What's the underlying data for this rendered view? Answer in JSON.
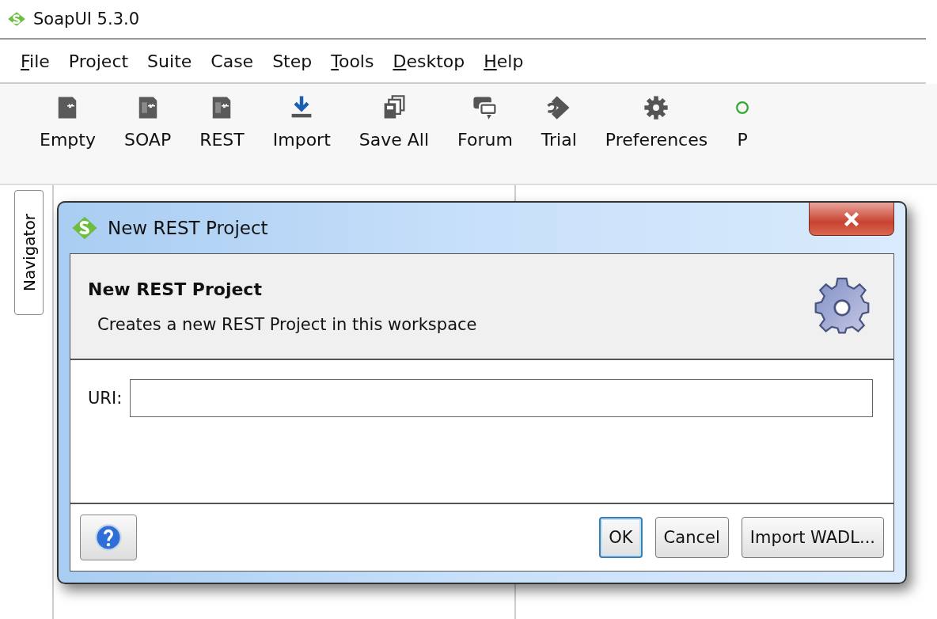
{
  "window": {
    "title": "SoapUI 5.3.0"
  },
  "menu": [
    {
      "label": "File",
      "underline_first": true
    },
    {
      "label": "Project",
      "underline_first": false
    },
    {
      "label": "Suite",
      "underline_first": false
    },
    {
      "label": "Case",
      "underline_first": false
    },
    {
      "label": "Step",
      "underline_first": false
    },
    {
      "label": "Tools",
      "underline_first": true
    },
    {
      "label": "Desktop",
      "underline_first": true
    },
    {
      "label": "Help",
      "underline_first": true
    }
  ],
  "toolbar": [
    {
      "label": "Empty",
      "kind": "empty"
    },
    {
      "label": "SOAP",
      "kind": "soap"
    },
    {
      "label": "REST",
      "kind": "rest"
    },
    {
      "label": "Import",
      "kind": "import"
    },
    {
      "label": "Save All",
      "kind": "saveall"
    },
    {
      "label": "Forum",
      "kind": "forum"
    },
    {
      "label": "Trial",
      "kind": "trial"
    },
    {
      "label": "Preferences",
      "kind": "gear"
    },
    {
      "label": "P",
      "kind": "proxy"
    }
  ],
  "side_tab": {
    "label": "Navigator"
  },
  "dialog": {
    "title": "New REST Project",
    "heading": "New REST Project",
    "description": "Creates a new REST Project in this workspace",
    "fields": [
      {
        "label": "URI:"
      }
    ],
    "buttons": [
      {
        "label": "OK",
        "default": true
      },
      {
        "label": "Cancel",
        "default": false
      },
      {
        "label": "Import WADL...",
        "default": false
      }
    ]
  }
}
